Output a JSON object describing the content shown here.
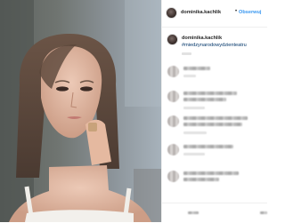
{
  "post": {
    "username": "dominika.kachlik",
    "separator": "•",
    "follow_label": "Obserwuj",
    "caption_hashtag": "#miedzynarodowydzienteatru"
  },
  "colors": {
    "follow_blue": "#3897f0",
    "hashtag_navy": "#003569",
    "text_dark": "#262626",
    "border": "#efefef"
  },
  "icons": {
    "profile_avatar": "avatar",
    "commenter_avatar": "avatar-blurred"
  }
}
